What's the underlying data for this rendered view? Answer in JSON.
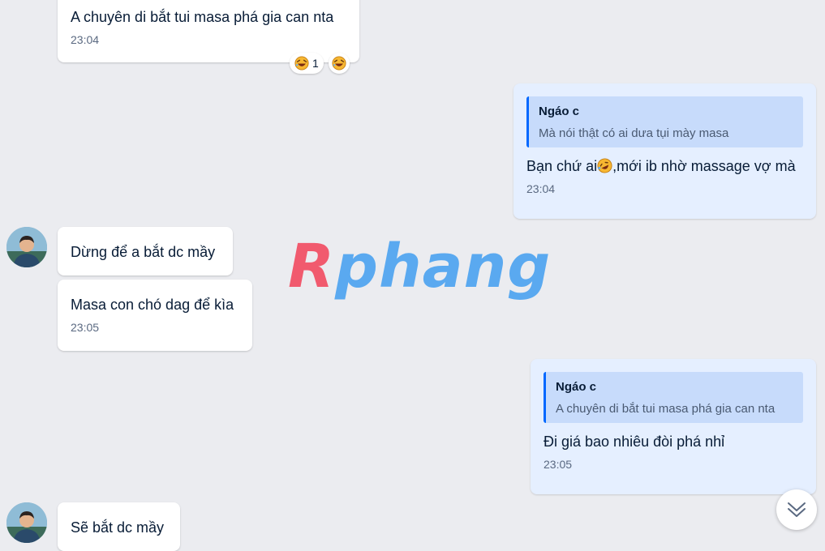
{
  "messages": {
    "m1": {
      "text": "A chuyên di bắt tui masa phá gia can nta",
      "time": "23:04"
    },
    "m2": {
      "quote_name": "Ngáo c",
      "quote_text": "Mà nói thật có ai dưa tụi mày masa",
      "text_before": "Bạn chứ ai",
      "text_after": ",mới ib nhờ massage vợ mà",
      "time": "23:04"
    },
    "m3": {
      "text": "Dừng để a bắt dc mầy"
    },
    "m4": {
      "text": "Masa con chó dag để kìa",
      "time": "23:05"
    },
    "m5": {
      "quote_name": "Ngáo c",
      "quote_text": "A chuyên di bắt tui masa phá gia can nta",
      "text": "Đi giá bao nhiêu đòi phá nhỉ",
      "time": "23:05"
    },
    "m6": {
      "text": "Sẽ bắt dc mầy"
    }
  },
  "reactions": {
    "count": "1",
    "emoji": "laughing-face-icon"
  },
  "watermark": {
    "part1": "R",
    "part2": "phang"
  },
  "icons": {
    "scroll_down": "double-chevron-down-icon"
  },
  "colors": {
    "background": "#ebecf0",
    "incoming_bubble": "#ffffff",
    "outgoing_bubble": "#e5efff",
    "quote_bg": "#c7dbfb",
    "quote_bar": "#0068ff"
  }
}
